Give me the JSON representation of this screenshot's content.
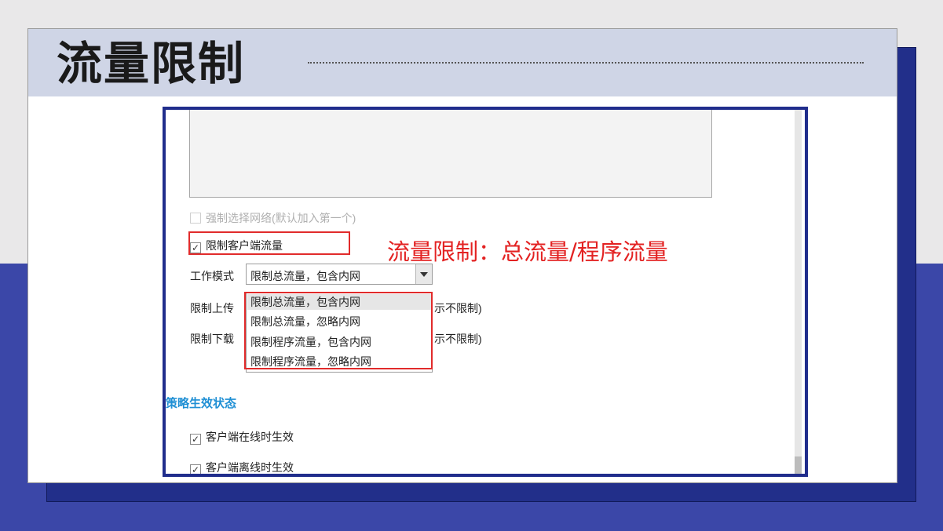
{
  "slide": {
    "title": "流量限制"
  },
  "panel": {
    "force_network_label": "强制选择网络(默认加入第一个)",
    "limit_client_traffic_label": "限制客户端流量",
    "limit_client_traffic_checked": true,
    "work_mode_label": "工作模式",
    "work_mode_value": "限制总流量，包含内网",
    "upload_label": "限制上传",
    "upload_suffix": "示不限制)",
    "download_label": "限制下载",
    "download_suffix": "示不限制)",
    "work_mode_options": [
      "限制总流量，包含内网",
      "限制总流量，忽略内网",
      "限制程序流量，包含内网",
      "限制程序流量，忽略内网"
    ],
    "policy_section_title": "策略生效状态",
    "effective_online_label": "客户端在线时生效",
    "effective_offline_label": "客户端离线时生效"
  },
  "annotation": {
    "text": "流量限制：总流量/程序流量",
    "color": "#e32222"
  },
  "colors": {
    "accent_blue": "#202d8c",
    "background_blue": "#3b47a8",
    "section_blue": "#1f8fd4"
  }
}
